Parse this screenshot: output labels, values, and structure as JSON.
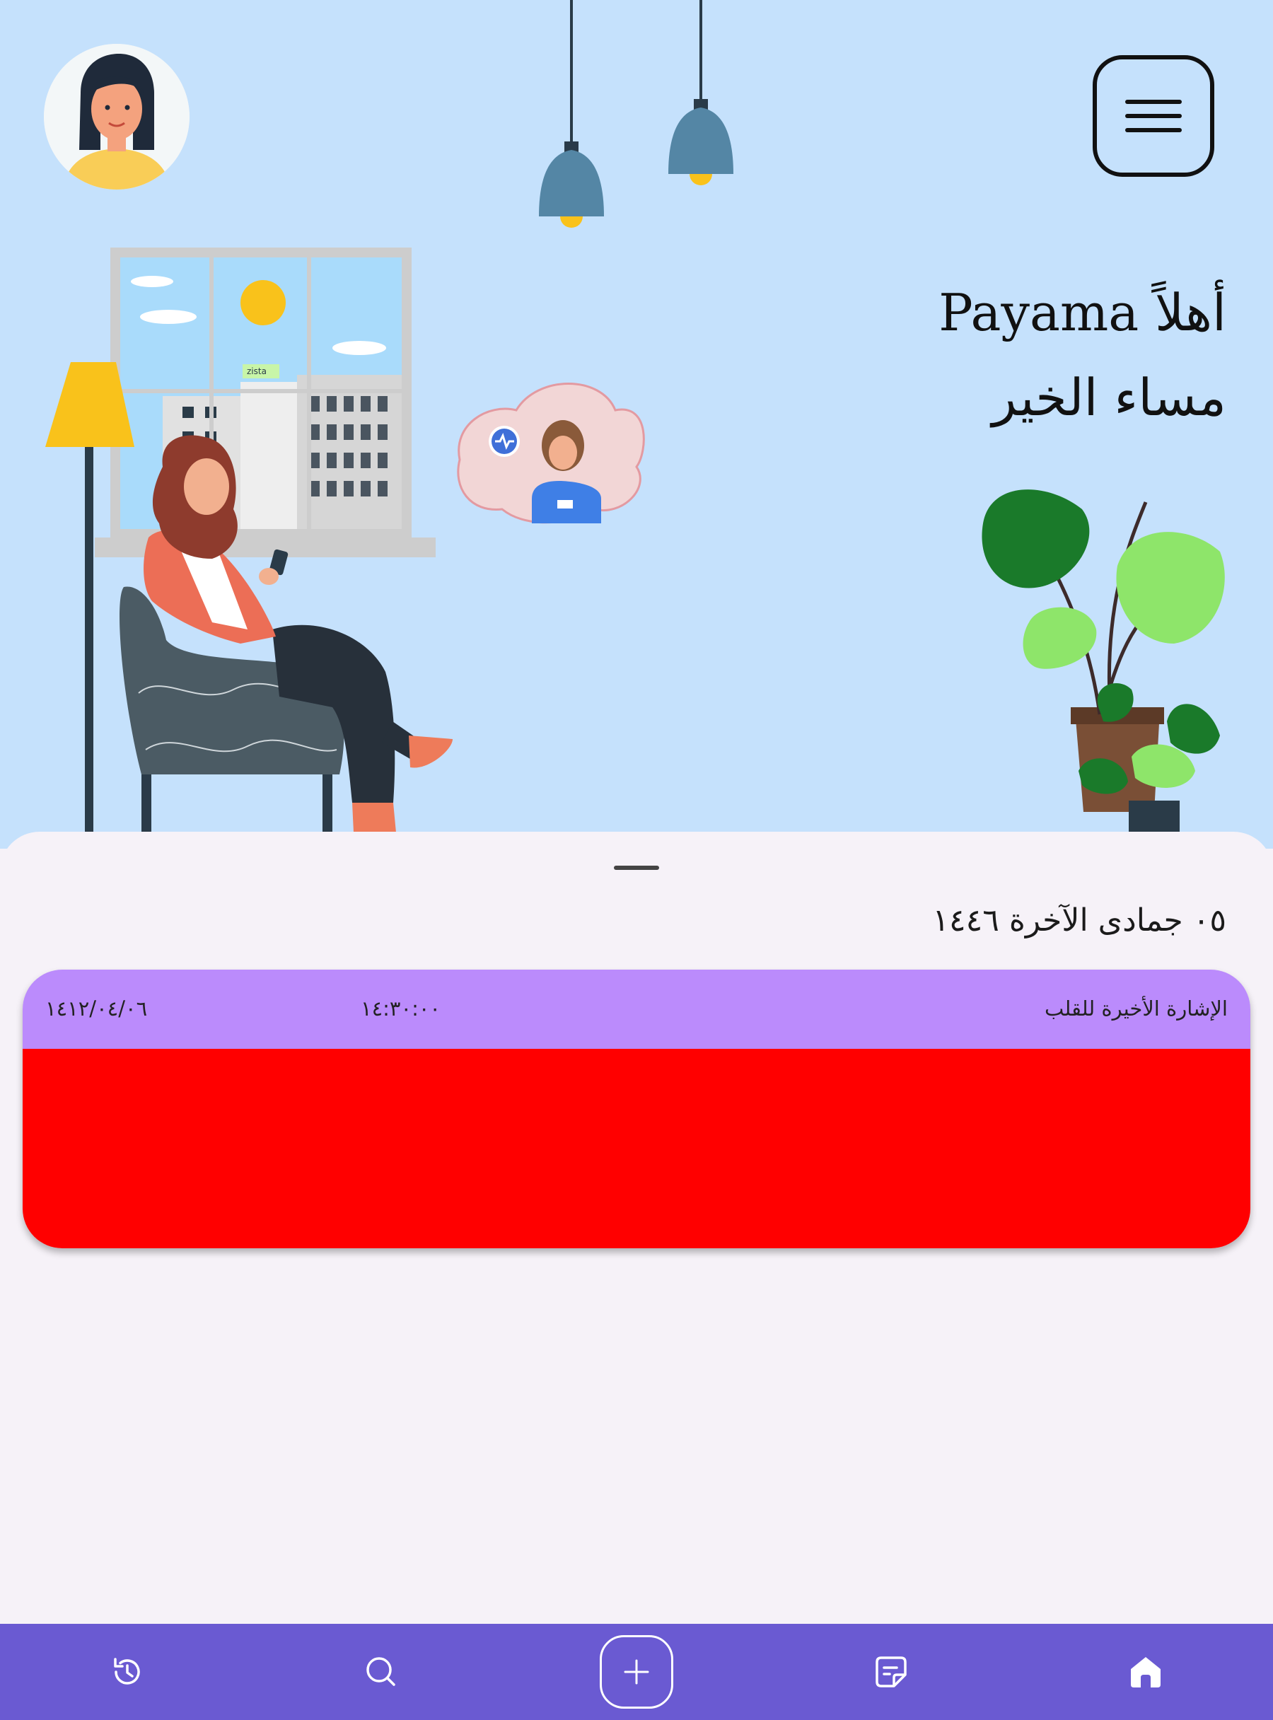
{
  "header": {
    "greeting_name": "أهلاً Payama",
    "greeting_time": "مساء الخير",
    "menu_icon": "hamburger-menu-icon",
    "avatar": "user-avatar"
  },
  "hero": {
    "window_sign": "zista"
  },
  "sheet": {
    "hijri_date": "٠٥ جمادى الآخرة ١٤٤٦",
    "card": {
      "title": "الإشارة الأخيرة للقلب",
      "time": "١٤:٣٠:٠٠",
      "date": "١٤١٢/٠٤/٠٦",
      "header_color": "#bb8bfc",
      "body_color": "#ff0000"
    }
  },
  "nav": {
    "background": "#6a5ad2",
    "items": [
      {
        "icon": "history-icon"
      },
      {
        "icon": "search-icon"
      },
      {
        "icon": "add-icon"
      },
      {
        "icon": "note-icon"
      },
      {
        "icon": "home-icon"
      }
    ]
  },
  "colors": {
    "hero_bg": "#c5e1fc",
    "sheet_bg": "#f6f2f8"
  }
}
